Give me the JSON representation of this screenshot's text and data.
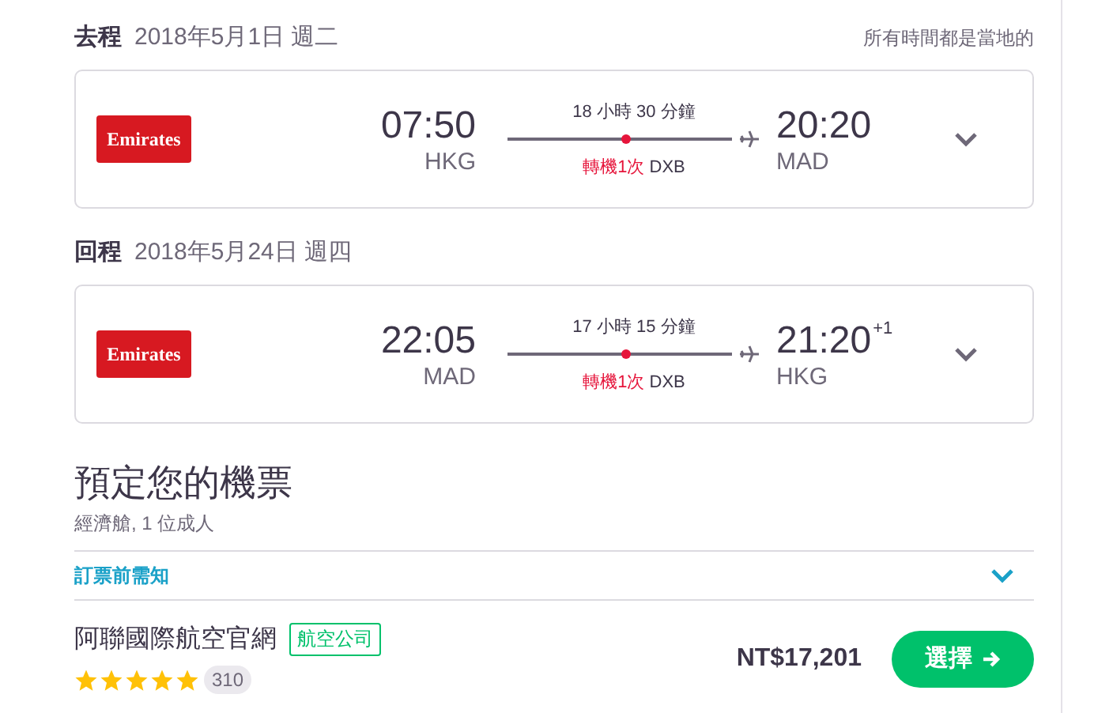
{
  "legs": [
    {
      "direction": "去程",
      "date": "2018年5月1日 週二",
      "note": "所有時間都是當地的",
      "airline": "Emirates",
      "depart_time": "07:50",
      "depart_airport": "HKG",
      "duration": "18 小時 30 分鐘",
      "stops": "轉機1次",
      "via": "DXB",
      "arrive_time": "20:20",
      "arrive_airport": "MAD"
    },
    {
      "direction": "回程",
      "date": "2018年5月24日 週四",
      "airline": "Emirates",
      "depart_time": "22:05",
      "depart_airport": "MAD",
      "duration": "17 小時 15 分鐘",
      "stops": "轉機1次",
      "via": "DXB",
      "arrive_time": "21:20",
      "arrive_airport": "HKG",
      "day_offset": "+1"
    }
  ],
  "booking": {
    "title": "預定您的機票",
    "subtitle": "經濟艙, 1 位成人",
    "notice": "訂票前需知",
    "notice_expanded": false
  },
  "offer": {
    "vendor": "阿聯國際航空官網",
    "tag": "航空公司",
    "stars": 5,
    "reviews": "310",
    "price": "NT$17,201",
    "button": "選擇"
  }
}
